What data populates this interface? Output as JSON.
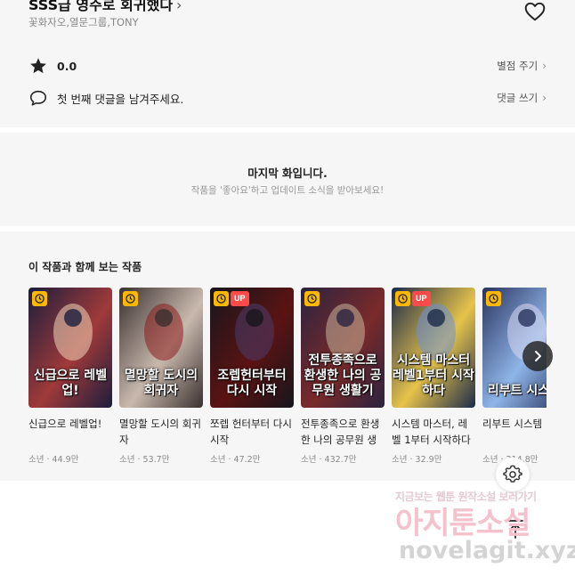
{
  "work": {
    "title": "SSS급 영주로 회귀했다",
    "authors": "꽃화자오,열문그룹,TONY"
  },
  "rating": {
    "value": "0.0",
    "action_label": "별점 주기"
  },
  "comment": {
    "prompt": "첫 번째 댓글을 남겨주세요.",
    "action_label": "댓글 쓰기"
  },
  "last_episode": {
    "title": "마지막 화입니다.",
    "subtitle": "작품을 '좋아요'하고 업데이트 소식을 받아보세요!"
  },
  "recommendations": {
    "section_title": "이 작품과 함께 보는 작품",
    "items": [
      {
        "title": "신급으로 레벨업!",
        "genre": "소년",
        "views": "44.9만",
        "up": false,
        "cover_text": "신급으로 레벨업!",
        "colors": [
          "#1b1e3d",
          "#a03a3a",
          "#f2d6b8"
        ]
      },
      {
        "title": "멸망할 도시의 회귀자",
        "genre": "소년",
        "views": "53.7만",
        "up": false,
        "cover_text": "멸망할 도시의 회귀자",
        "colors": [
          "#3a3030",
          "#c9b9ad",
          "#8a1d1d"
        ]
      },
      {
        "title": "쪼렙 헌터부터 다시 시작",
        "genre": "소년",
        "views": "47.2만",
        "up": true,
        "cover_text": "조렙헌터부터 다시 시작",
        "colors": [
          "#16161d",
          "#5b1313",
          "#4a3d6b"
        ]
      },
      {
        "title": "전투종족으로 환생한 나의 공무원 생활기",
        "genre": "소년",
        "views": "432.7만",
        "up": false,
        "cover_text": "전투종족으로 환생한 나의 공무원 생활기",
        "colors": [
          "#2a2340",
          "#7a2a2a",
          "#c7b59b"
        ]
      },
      {
        "title": "시스템 마스터, 레벨 1부터 시작하다",
        "genre": "소년",
        "views": "32.9만",
        "up": true,
        "cover_text": "시스템 마스터 레벨1부터 시작하다",
        "colors": [
          "#1c2a4a",
          "#e6c34a",
          "#6b8fd6"
        ]
      },
      {
        "title": "리부트 시스템",
        "genre": "소년",
        "views": "214.8만",
        "up": false,
        "cover_text": "리부트 시스템",
        "colors": [
          "#29335e",
          "#8fb5e8",
          "#d9d9f2"
        ]
      }
    ]
  },
  "watermark": {
    "line1": "지금보는 웹툰 원작소설 보러가기",
    "line2": "아지툰소설",
    "line3": "novelagit.xyz"
  }
}
